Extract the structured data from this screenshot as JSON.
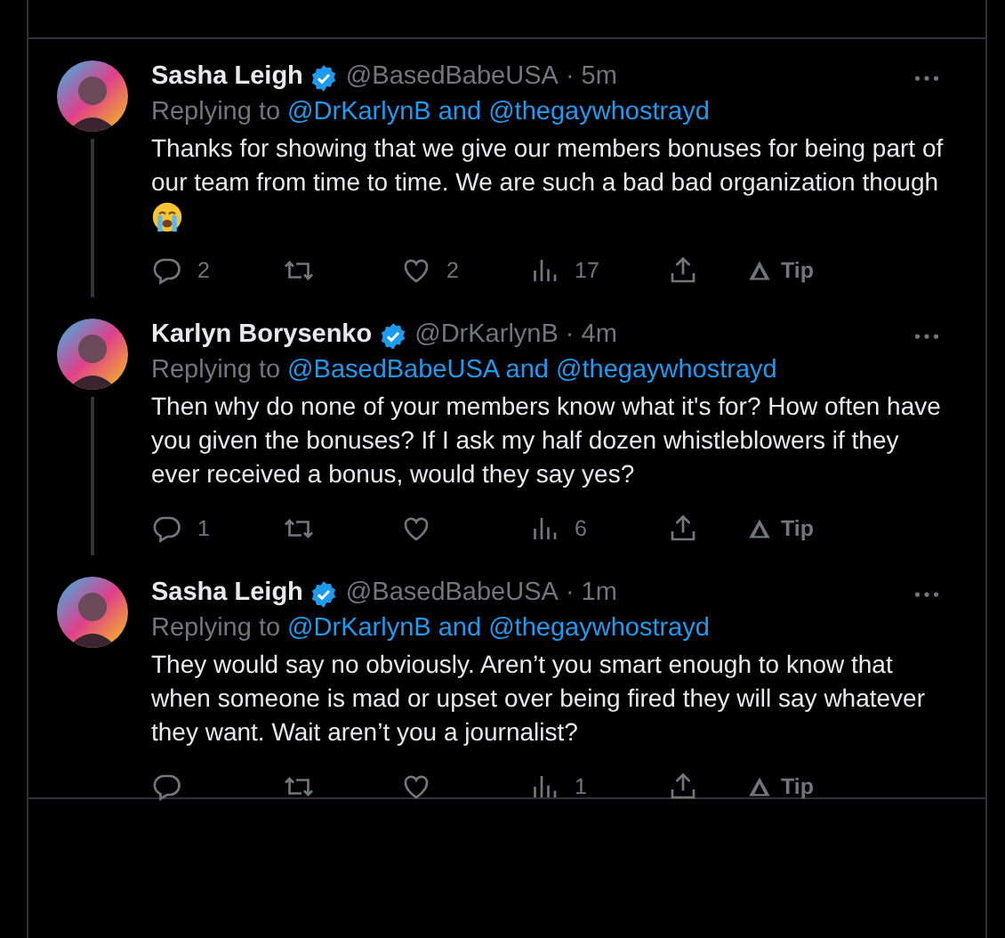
{
  "tweets": [
    {
      "name": "Sasha Leigh",
      "verified": true,
      "handle": "@BasedBabeUSA",
      "time": "· 5m",
      "replying_label": "Replying to",
      "replying_to": "@DrKarlynB and @thegaywhostrayd",
      "text": "Thanks for showing that we give our members bonuses for being part of our team from time to time. We are such a bad bad organization though",
      "crying_emoji": true,
      "thread_line": true,
      "replies": "2",
      "likes": "2",
      "views": "17",
      "tip": "Tip"
    },
    {
      "name": "Karlyn Borysenko",
      "verified": true,
      "handle": "@DrKarlynB",
      "time": "· 4m",
      "replying_label": "Replying to",
      "replying_to": "@BasedBabeUSA and @thegaywhostrayd",
      "text": "Then why do none of your members know what it's for? How often have you given the bonuses? If I ask my half dozen whistleblowers if they ever received a bonus, would they say yes?",
      "crying_emoji": false,
      "thread_line": true,
      "replies": "1",
      "views": "6",
      "tip": "Tip"
    },
    {
      "name": "Sasha Leigh",
      "verified": true,
      "handle": "@BasedBabeUSA",
      "time": "· 1m",
      "replying_label": "Replying to",
      "replying_to": "@DrKarlynB and @thegaywhostrayd",
      "text": "They would say no obviously. Aren’t you smart enough to know that when someone is mad or upset over being fired they will say whatever they want. Wait aren’t you a journalist?",
      "crying_emoji": false,
      "thread_line": false,
      "views": "1",
      "tip": "Tip"
    }
  ]
}
